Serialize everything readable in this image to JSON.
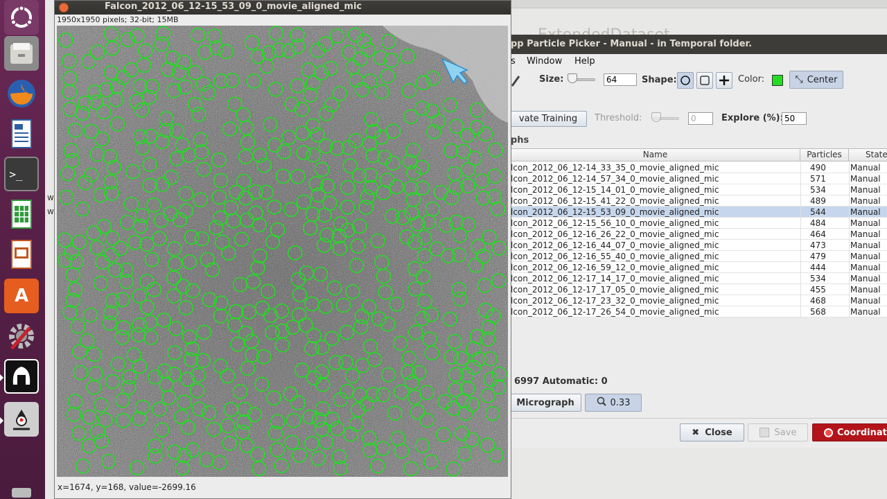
{
  "image_window": {
    "title": "Falcon_2012_06_12-15_53_09_0_movie_aligned_mic",
    "info": "1950x1950 pixels; 32-bit; 15MB",
    "status": "x=1674, y=168, value=-2699.16"
  },
  "background": {
    "extended_title": "ExtendedDataset",
    "side_text_1": "w",
    "side_text_2": "w"
  },
  "picker": {
    "title": "pp Particle Picker - Manual - in Temporal folder.",
    "menu": [
      "s",
      "Window",
      "Help"
    ],
    "size_label": "Size:",
    "size_value": "64",
    "shape_label": "Shape:",
    "color_label": "Color:",
    "center_label": "Center",
    "color_value": "#22dd22",
    "training_button": "vate Training",
    "threshold_label": "Threshold:",
    "threshold_value": "0",
    "explore_label": "Explore (%):",
    "explore_value": "50",
    "micrographs_section": "phs",
    "table": {
      "columns": [
        "Name",
        "Particles",
        "State"
      ],
      "rows": [
        {
          "name": "lcon_2012_06_12-14_33_35_0_movie_aligned_mic",
          "particles": "490",
          "state": "Manual"
        },
        {
          "name": "lcon_2012_06_12-14_57_34_0_movie_aligned_mic",
          "particles": "571",
          "state": "Manual"
        },
        {
          "name": "lcon_2012_06_12-15_14_01_0_movie_aligned_mic",
          "particles": "534",
          "state": "Manual"
        },
        {
          "name": "lcon_2012_06_12-15_41_22_0_movie_aligned_mic",
          "particles": "489",
          "state": "Manual"
        },
        {
          "name": "lcon_2012_06_12-15_53_09_0_movie_aligned_mic",
          "particles": "544",
          "state": "Manual"
        },
        {
          "name": "lcon_2012_06_12-15_56_10_0_movie_aligned_mic",
          "particles": "484",
          "state": "Manual"
        },
        {
          "name": "lcon_2012_06_12-16_26_22_0_movie_aligned_mic",
          "particles": "464",
          "state": "Manual"
        },
        {
          "name": "lcon_2012_06_12-16_44_07_0_movie_aligned_mic",
          "particles": "473",
          "state": "Manual"
        },
        {
          "name": "lcon_2012_06_12-16_55_40_0_movie_aligned_mic",
          "particles": "479",
          "state": "Manual"
        },
        {
          "name": "lcon_2012_06_12-16_59_12_0_movie_aligned_mic",
          "particles": "444",
          "state": "Manual"
        },
        {
          "name": "lcon_2012_06_12-17_14_17_0_movie_aligned_mic",
          "particles": "534",
          "state": "Manual"
        },
        {
          "name": "lcon_2012_06_12-17_17_05_0_movie_aligned_mic",
          "particles": "455",
          "state": "Manual"
        },
        {
          "name": "lcon_2012_06_12-17_23_32_0_movie_aligned_mic",
          "particles": "468",
          "state": "Manual"
        },
        {
          "name": "lcon_2012_06_12-17_26_54_0_movie_aligned_mic",
          "particles": "568",
          "state": "Manual"
        }
      ],
      "selected_index": 4
    },
    "counts_text": "6997  Automatic: 0",
    "micrograph_button": "Micrograph",
    "zoom_value": "0.33",
    "close_button": "Close",
    "save_button": "Save",
    "coordinates_button": "Coordinat"
  },
  "launcher": {
    "icons": [
      "ubuntu-logo-icon",
      "files-icon",
      "firefox-icon",
      "writer-icon",
      "terminal-icon",
      "calc-icon",
      "impress-icon",
      "software-center-icon",
      "settings-icon",
      "spartan-helmet-icon",
      "java-icon",
      "trash-icon"
    ]
  }
}
